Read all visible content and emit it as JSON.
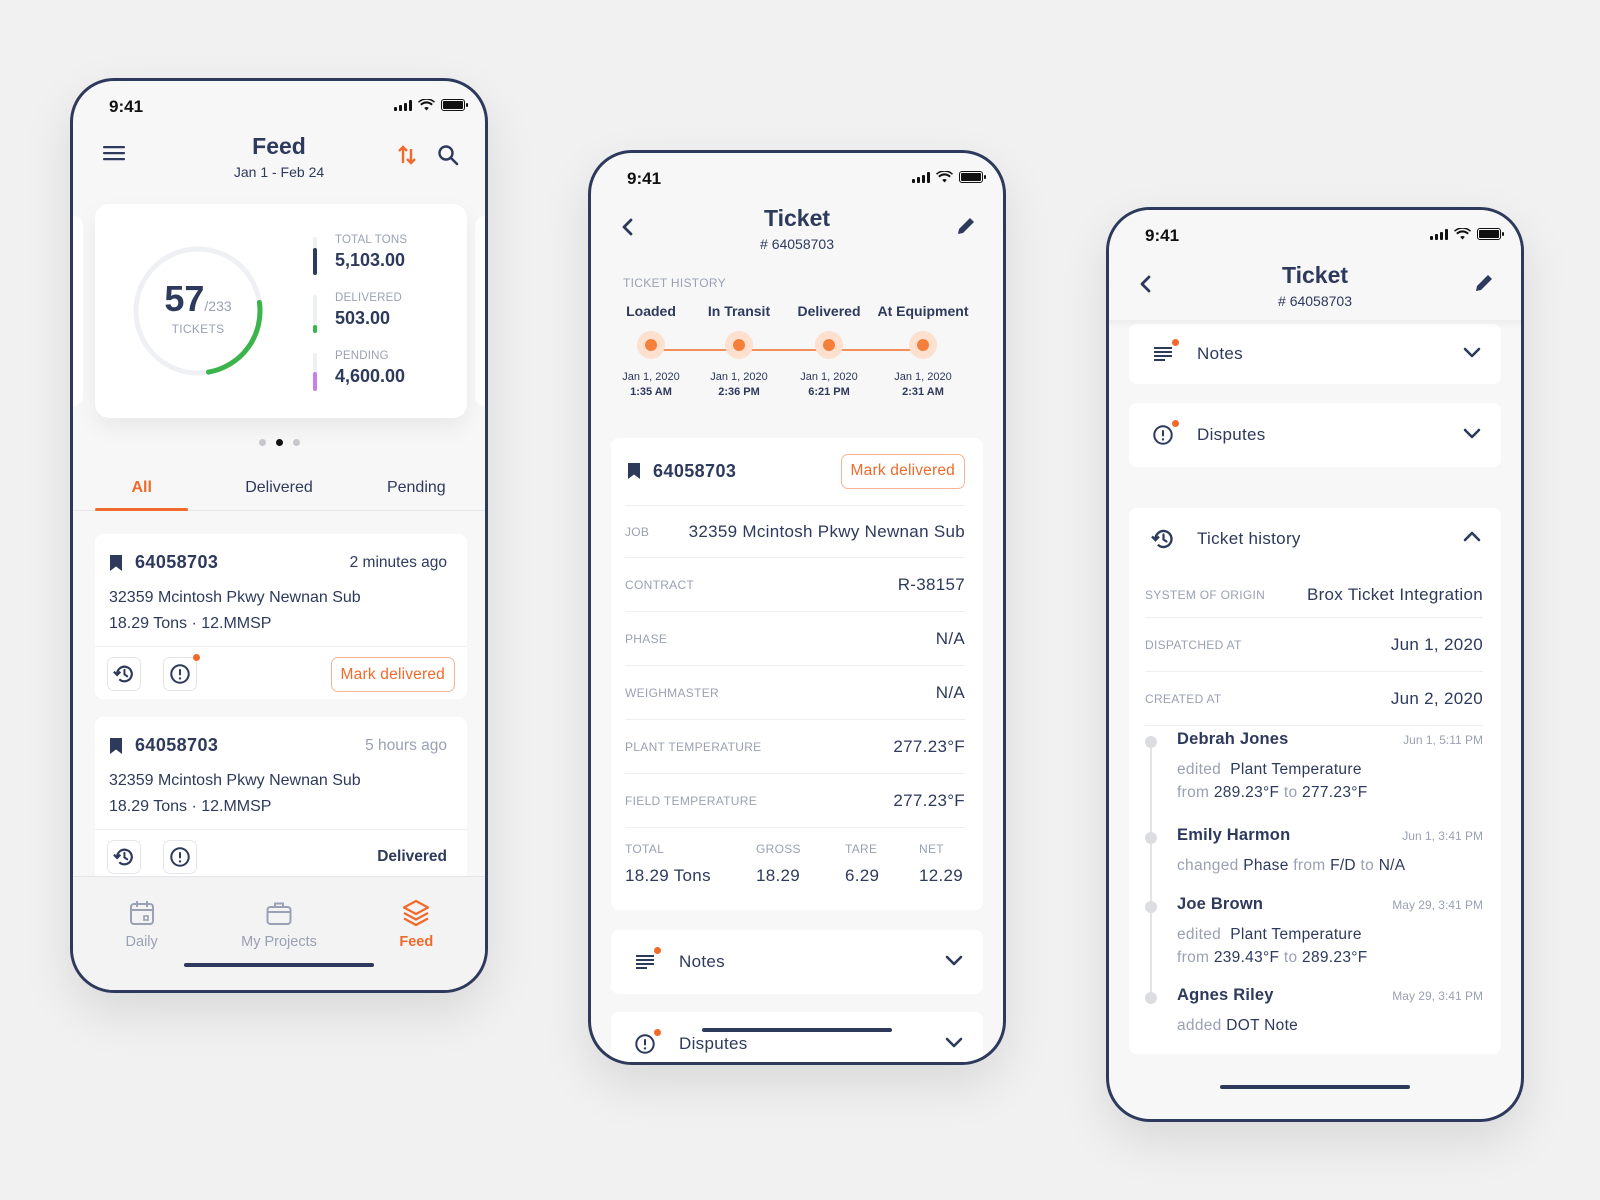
{
  "status_bar": {
    "time": "9:41"
  },
  "colors": {
    "accent": "#f06a2b",
    "navy": "#2e3a5c",
    "muted": "#9aa1b4",
    "green": "#3bb54a",
    "purple": "#c77ff0"
  },
  "feed_screen": {
    "title": "Feed",
    "date_range": "Jan 1 - Feb 24",
    "icons": {
      "menu": "menu-icon",
      "sort": "sort-icon",
      "search": "search-icon"
    },
    "summary": {
      "tickets_done": "57",
      "tickets_total": "/233",
      "tickets_caption": "TICKETS",
      "progress_fraction": 0.245,
      "stats": [
        {
          "label": "TOTAL TONS",
          "value": "5,103.00",
          "fill_fraction": 0.7,
          "color": "#2e3a5c"
        },
        {
          "label": "DELIVERED",
          "value": "503.00",
          "fill_fraction": 0.2,
          "color": "#3bb54a"
        },
        {
          "label": "PENDING",
          "value": "4,600.00",
          "fill_fraction": 0.5,
          "color": "#c77ff0"
        }
      ],
      "pager": {
        "count": 3,
        "active": 1
      }
    },
    "tabs": [
      {
        "label": "All",
        "active": true
      },
      {
        "label": "Delivered",
        "active": false
      },
      {
        "label": "Pending",
        "active": false
      }
    ],
    "tickets": [
      {
        "id": "64058703",
        "time": "2 minutes ago",
        "address": "32359 Mcintosh Pkwy Newnan Sub",
        "meta": "18.29 Tons · 12.MMSP",
        "action": "Mark delivered",
        "has_dispute_badge": true
      },
      {
        "id": "64058703",
        "time": "5 hours ago",
        "address": "32359 Mcintosh Pkwy Newnan Sub",
        "meta": "18.29 Tons · 12.MMSP",
        "status": "Delivered",
        "has_dispute_badge": false
      }
    ],
    "bottom_nav": [
      {
        "label": "Daily",
        "icon": "calendar-icon",
        "active": false
      },
      {
        "label": "My Projects",
        "icon": "briefcase-icon",
        "active": false
      },
      {
        "label": "Feed",
        "icon": "layers-icon",
        "active": true
      }
    ]
  },
  "ticket_screen": {
    "title": "Ticket",
    "subtitle": "# 64058703",
    "history_label": "TICKET HISTORY",
    "history_steps": [
      {
        "name": "Loaded",
        "date": "Jan 1, 2020",
        "time": "1:35 AM"
      },
      {
        "name": "In Transit",
        "date": "Jan 1, 2020",
        "time": "2:36 PM"
      },
      {
        "name": "Delivered",
        "date": "Jan 1, 2020",
        "time": "6:21 PM"
      },
      {
        "name": "At Equipment",
        "date": "Jan 1, 2020",
        "time": "2:31 AM"
      }
    ],
    "ticket_id": "64058703",
    "mark_delivered": "Mark delivered",
    "fields": [
      {
        "label": "JOB",
        "value": "32359 Mcintosh Pkwy Newnan Sub"
      },
      {
        "label": "CONTRACT",
        "value": "R-38157"
      },
      {
        "label": "PHASE",
        "value": "N/A"
      },
      {
        "label": "WEIGHMASTER",
        "value": "N/A"
      },
      {
        "label": "PLANT TEMPERATURE",
        "value": "277.23°F"
      },
      {
        "label": "FIELD TEMPERATURE",
        "value": "277.23°F"
      }
    ],
    "totals": [
      {
        "label": "TOTAL",
        "value": "18.29 Tons"
      },
      {
        "label": "GROSS",
        "value": "18.29"
      },
      {
        "label": "TARE",
        "value": "6.29"
      },
      {
        "label": "NET",
        "value": "12.29"
      }
    ],
    "sections": [
      {
        "label": "Notes",
        "icon": "notes-icon",
        "badge": true
      },
      {
        "label": "Disputes",
        "icon": "alert-circle-icon",
        "badge": true
      }
    ]
  },
  "ticket_history_screen": {
    "title": "Ticket",
    "subtitle": "# 64058703",
    "sections": [
      {
        "label": "Notes",
        "icon": "notes-icon",
        "badge": true,
        "expanded": false
      },
      {
        "label": "Disputes",
        "icon": "alert-circle-icon",
        "badge": true,
        "expanded": false
      },
      {
        "label": "Ticket history",
        "icon": "history-icon",
        "badge": false,
        "expanded": true
      }
    ],
    "meta": [
      {
        "label": "SYSTEM OF ORIGIN",
        "value": "Brox Ticket Integration"
      },
      {
        "label": "DISPATCHED AT",
        "value": "Jun 1, 2020"
      },
      {
        "label": "CREATED AT",
        "value": "Jun 2, 2020"
      }
    ],
    "log": [
      {
        "user": "Debrah Jones",
        "time": "Jun 1, 5:11 PM",
        "verb": "edited",
        "field": "Plant Temperature",
        "from": "289.23°F",
        "to": "277.23°F"
      },
      {
        "user": "Emily Harmon",
        "time": "Jun 1, 3:41 PM",
        "verb": "changed",
        "field": "Phase",
        "from": "F/D",
        "to": "N/A"
      },
      {
        "user": "Joe Brown",
        "time": "May 29, 3:41 PM",
        "verb": "edited",
        "field": "Plant Temperature",
        "from": "239.43°F",
        "to": "289.23°F"
      },
      {
        "user": "Agnes Riley",
        "time": "May 29, 3:41 PM",
        "verb": "added",
        "field": "DOT Note"
      }
    ],
    "words": {
      "from": "from",
      "to": "to"
    }
  }
}
